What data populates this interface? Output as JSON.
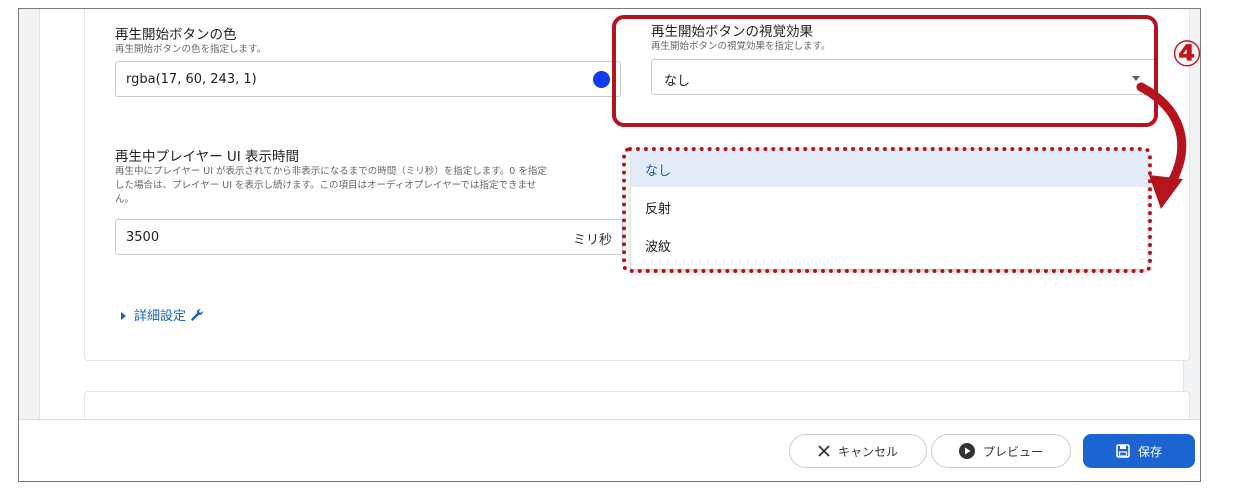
{
  "fields": {
    "play_button_color": {
      "title": "再生開始ボタンの色",
      "description": "再生開始ボタンの色を指定します。",
      "value": "rgba(17, 60, 243, 1)",
      "swatch_color": "#113cf3"
    },
    "play_button_effect": {
      "title": "再生開始ボタンの視覚効果",
      "description": "再生開始ボタンの視覚効果を指定します。",
      "selected_value": "なし",
      "options": [
        "なし",
        "反射",
        "波紋"
      ]
    },
    "player_ui_display_time": {
      "title": "再生中プレイヤー UI 表示時間",
      "description_lines": [
        "再生中にプレイヤー UI が表示されてから非表示になるまでの時間（ミリ秒）を指定します。0 を指定",
        "した場合は、プレイヤー UI を表示し続けます。この項目はオーディオプレイヤーでは指定できませ",
        "ん。"
      ],
      "value": "3500",
      "unit": "ミリ秒"
    }
  },
  "advanced_settings_label": "詳細設定",
  "annotation": {
    "step_number": "④",
    "color": "#b5141e"
  },
  "footer": {
    "cancel_label": "キャンセル",
    "preview_label": "プレビュー",
    "save_label": "保存"
  },
  "colors": {
    "accent": "#1c64d1",
    "link": "#1565c0",
    "selected_option_bg": "#e3ebf8"
  }
}
